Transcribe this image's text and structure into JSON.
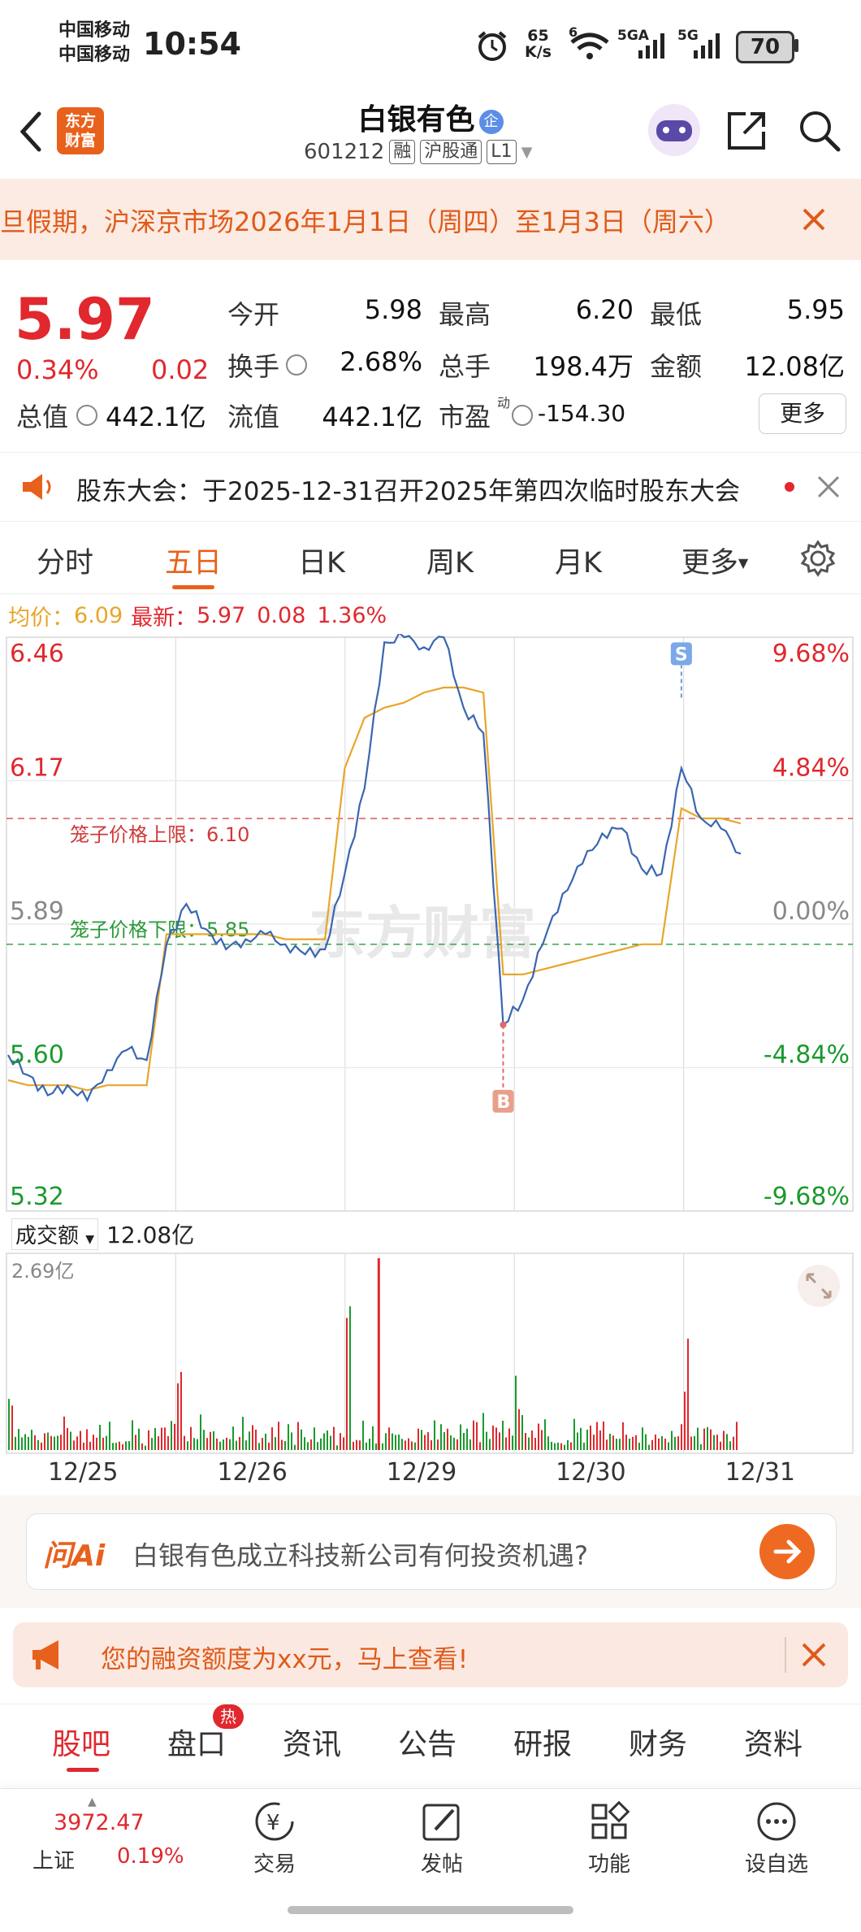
{
  "status": {
    "carrier1": "中国移动",
    "carrier2": "中国移动",
    "time": "10:54",
    "net_speed": "65",
    "net_unit": "K/s",
    "battery": "70",
    "sig1": "5GA",
    "sig2": "5G",
    "wifi_sub": "6"
  },
  "header": {
    "logo_line1": "东方",
    "logo_line2": "财富",
    "title": "白银有色",
    "title_badge": "企",
    "code": "601212",
    "tag1": "融",
    "tag2": "沪股通",
    "tag3": "L1"
  },
  "notice": {
    "text": "旦假期，沪深京市场2026年1月1日（周四）至1月3日（周六）"
  },
  "quote": {
    "price": "5.97",
    "change_pct": "0.34%",
    "change": "0.02",
    "open_label": "今开",
    "open": "5.98",
    "high_label": "最高",
    "high": "6.20",
    "low_label": "最低",
    "low": "5.95",
    "turnover_label": "换手",
    "turnover": "2.68%",
    "volume_label": "总手",
    "volume": "198.4万",
    "amount_label": "金额",
    "amount": "12.08亿",
    "mcap_label": "总值",
    "mcap": "442.1亿",
    "float_label": "流值",
    "float": "442.1亿",
    "pe_label": "市盈",
    "pe_sup": "动",
    "pe": "-154.30",
    "more": "更多"
  },
  "announcement": {
    "text": "股东大会：于2025-12-31召开2025年第四次临时股东大会"
  },
  "chart_tabs": {
    "t1": "分时",
    "t2": "五日",
    "t3": "日K",
    "t4": "周K",
    "t5": "月K",
    "t6": "更多"
  },
  "avg_line": {
    "label": "均价：",
    "avg": "6.09",
    "latest_label": "最新：",
    "latest": "5.97",
    "chg": "0.08",
    "pct": "1.36%"
  },
  "chart_data": {
    "type": "line",
    "title": "",
    "x_labels": [
      "12/25",
      "12/26",
      "12/29",
      "12/30",
      "12/31"
    ],
    "ylim": [
      5.32,
      6.46
    ],
    "y_ticks_left": [
      "6.46",
      "6.17",
      "5.89",
      "5.60",
      "5.32"
    ],
    "y_ticks_right": [
      "9.68%",
      "4.84%",
      "0.00%",
      "-4.84%",
      "-9.68%"
    ],
    "series": [
      {
        "name": "价格",
        "values": [
          5.63,
          5.59,
          5.55,
          5.57,
          5.54,
          5.6,
          5.64,
          5.62,
          5.85,
          5.93,
          5.88,
          5.84,
          5.86,
          5.87,
          5.85,
          5.83,
          5.84,
          5.99,
          6.16,
          6.45,
          6.46,
          6.44,
          6.46,
          6.32,
          6.27,
          5.69,
          5.74,
          5.85,
          5.95,
          6.01,
          6.07,
          6.08,
          6.0,
          5.99,
          6.2,
          6.1,
          6.08,
          6.03
        ]
      },
      {
        "name": "均价",
        "values": [
          5.58,
          5.57,
          5.57,
          5.57,
          5.56,
          5.57,
          5.57,
          5.57,
          5.87,
          5.87,
          5.87,
          5.87,
          5.87,
          5.87,
          5.86,
          5.86,
          5.86,
          6.2,
          6.3,
          6.32,
          6.33,
          6.35,
          6.36,
          6.36,
          6.35,
          5.79,
          5.79,
          5.8,
          5.81,
          5.82,
          5.83,
          5.84,
          5.85,
          5.85,
          6.12,
          6.1,
          6.1,
          6.09
        ]
      }
    ],
    "annotations": {
      "upper_limit_label": "笼子价格上限：6.10",
      "upper_limit": 6.1,
      "lower_limit_label": "笼子价格下限：5.85",
      "lower_limit": 5.85,
      "buy_label": "B",
      "buy_price": 5.69,
      "sell_label": "S",
      "sell_price": 6.34
    },
    "volume": {
      "label": "成交额",
      "total": "12.08亿",
      "max_label": "2.69亿"
    }
  },
  "ai": {
    "logo": "问Ai",
    "question": "白银有色成立科技新公司有何投资机遇?"
  },
  "promo": {
    "text": "您的融资额度为xx元，马上查看!"
  },
  "content_tabs": [
    "股吧",
    "盘口",
    "资讯",
    "公告",
    "研报",
    "财务",
    "资料"
  ],
  "hot_badge": "热",
  "bottom_nav": {
    "index_value": "3972.47",
    "index_name": "上证",
    "index_pct": "0.19%",
    "n1": "交易",
    "n2": "发帖",
    "n3": "功能",
    "n4": "设自选"
  },
  "colors": {
    "accent": "#e8611c",
    "up": "#e0282e",
    "down": "#1a9a2e",
    "price_line": "#3a66b0",
    "avg_line": "#e8a62a"
  }
}
